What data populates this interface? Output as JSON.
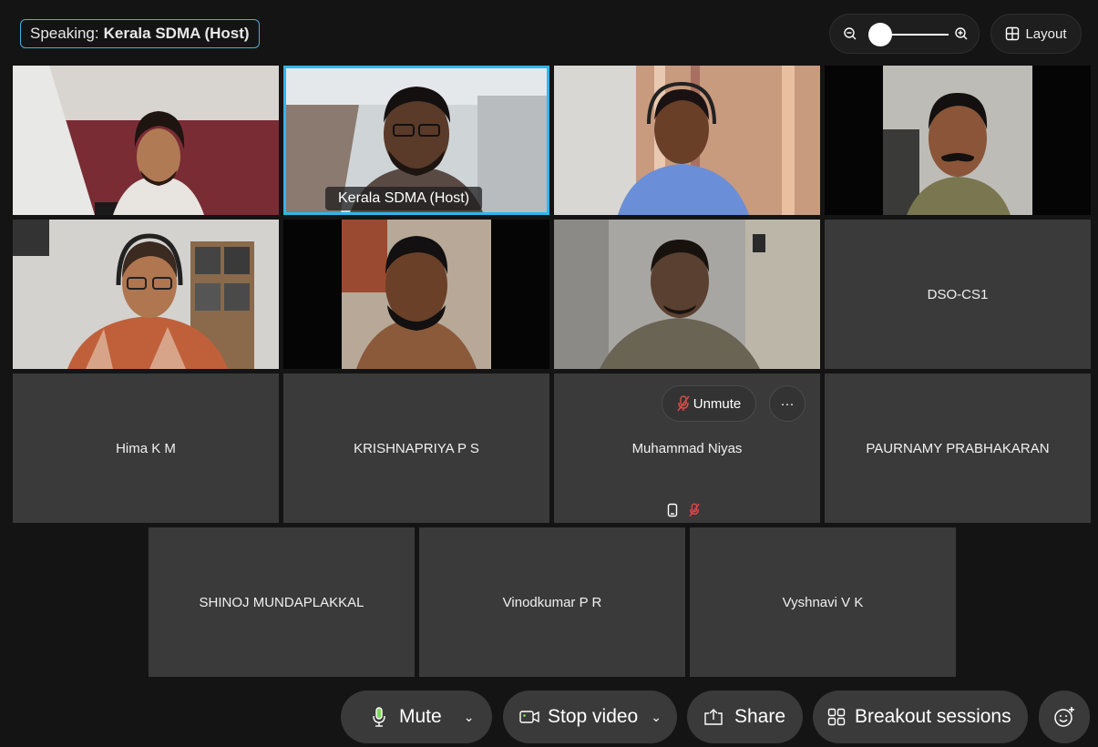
{
  "top": {
    "speaking_prefix": "Speaking:",
    "speaking_name": "Kerala SDMA (Host)",
    "layout_label": "Layout"
  },
  "participants": {
    "host_label": "Kerala SDMA  (Host)",
    "p1": "DSO-CS1",
    "p2": "Hima K M",
    "p3": "KRISHNAPRIYA P S",
    "p4": "Muhammad Niyas",
    "p5": "PAURNAMY PRABHAKARAN",
    "p6": "SHINOJ MUNDAPLAKKAL",
    "p7": "Vinodkumar P R",
    "p8": "Vyshnavi V K"
  },
  "hover": {
    "unmute_label": "Unmute",
    "more_label": "···"
  },
  "controls": {
    "mute": "Mute",
    "stop_video": "Stop video",
    "share": "Share",
    "breakout": "Breakout sessions"
  },
  "colors": {
    "accent": "#2fb6ee",
    "muted_red": "#e04848"
  }
}
